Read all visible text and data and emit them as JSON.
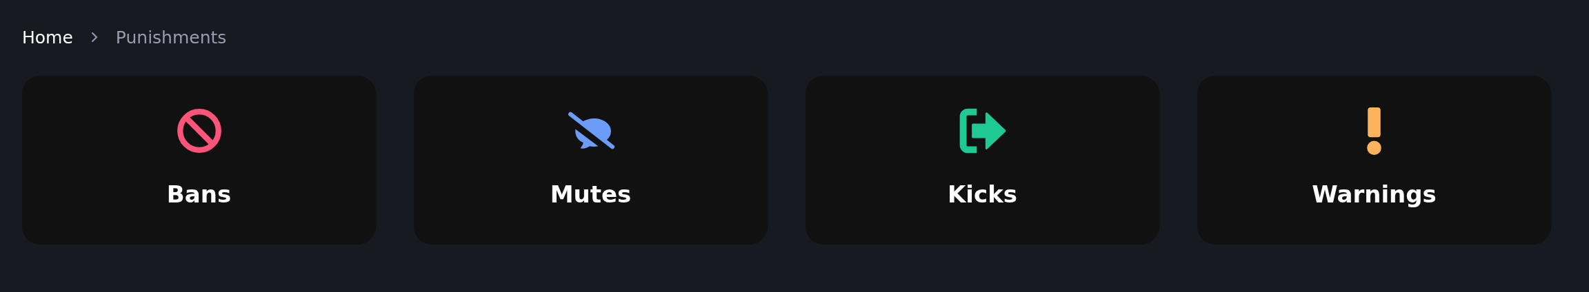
{
  "breadcrumb": {
    "items": [
      {
        "label": "Home",
        "selected": false
      },
      {
        "label": "Punishments",
        "selected": true
      }
    ]
  },
  "cards": [
    {
      "title": "Bans",
      "kind": "ban",
      "color": "#fd5479"
    },
    {
      "title": "Mutes",
      "kind": "mute",
      "color": "#6a9cf8"
    },
    {
      "title": "Kicks",
      "kind": "kick",
      "color": "#1ec994"
    },
    {
      "title": "Warnings",
      "kind": "warning",
      "color": "#feb35c"
    }
  ]
}
